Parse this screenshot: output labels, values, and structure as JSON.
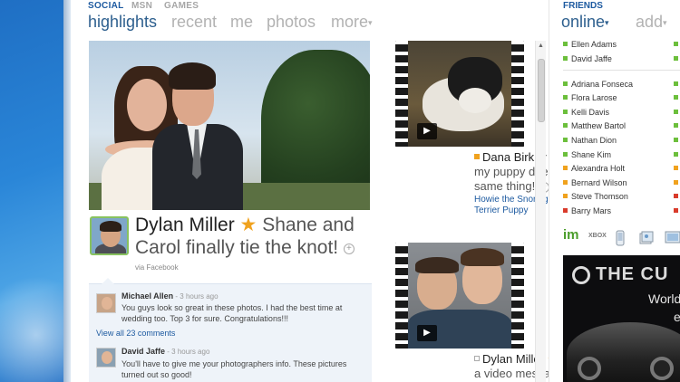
{
  "categories": {
    "social": "SOCIAL",
    "msn": "MSN",
    "games": "GAMES"
  },
  "tabs": {
    "highlights": "highlights",
    "recent": "recent",
    "me": "me",
    "photos": "photos",
    "more": "more",
    "chev": "▾"
  },
  "post": {
    "author": "Dylan Miller",
    "star": "★",
    "text": " Shane and Carol finally tie the knot!",
    "plus": "+",
    "via": "via Facebook"
  },
  "comments": [
    {
      "name": "Michael Allen",
      "time": " - 3 hours ago",
      "text": "You guys look so great in these photos. I had the best time at wedding too. Top 3 for sure. Congratulations!!!"
    },
    {
      "name": "David Jaffe",
      "time": " - 3 hours ago",
      "text": "You'll have to give me your photographers info. These pictures turned out so good!"
    }
  ],
  "view_all": "View all 23 comments",
  "video1": {
    "author": "Dana Birkby",
    "star": "★",
    "text": " Awww, my puppy does the same thing!",
    "plus": "+",
    "link": "Howie the Snoring Boston Terrier Puppy",
    "play": "▶"
  },
  "video2": {
    "author": "Dylan Miller",
    "star": "★",
    "text": " sent you a video message",
    "play": "▶"
  },
  "friends": {
    "category": "FRIENDS",
    "online": "online",
    "add": "add",
    "chev": "▾",
    "group1": [
      {
        "name": "Ellen Adams",
        "status": "online"
      },
      {
        "name": "David Jaffe",
        "status": "online"
      }
    ],
    "group2": [
      {
        "name": "Adriana Fonseca",
        "status": "online"
      },
      {
        "name": "Flora Larose",
        "status": "online"
      },
      {
        "name": "Kelli Davis",
        "status": "online"
      },
      {
        "name": "Matthew Bartol",
        "status": "online"
      },
      {
        "name": "Nathan Dion",
        "status": "online"
      },
      {
        "name": "Shane Kim",
        "status": "online"
      },
      {
        "name": "Alexandra Holt",
        "status": "away"
      },
      {
        "name": "Bernard Wilson",
        "status": "away"
      },
      {
        "name": "Steve Thomson",
        "status": "away"
      },
      {
        "name": "Barry Mars",
        "status": "busy"
      }
    ],
    "col2_letters": [
      "E",
      "",
      "B",
      "",
      "",
      "",
      "",
      "",
      "A",
      "",
      "",
      "E"
    ]
  },
  "apps": {
    "im": "im",
    "xbox": "XBOX"
  },
  "ad": {
    "title": "THE CU",
    "line1": "World",
    "line2": "e"
  },
  "colors": {
    "accent": "#1d5aa0",
    "tab_active": "#2d5f8e",
    "online": "#6cbf3c",
    "away": "#f0a21e",
    "busy": "#d93b2b"
  }
}
